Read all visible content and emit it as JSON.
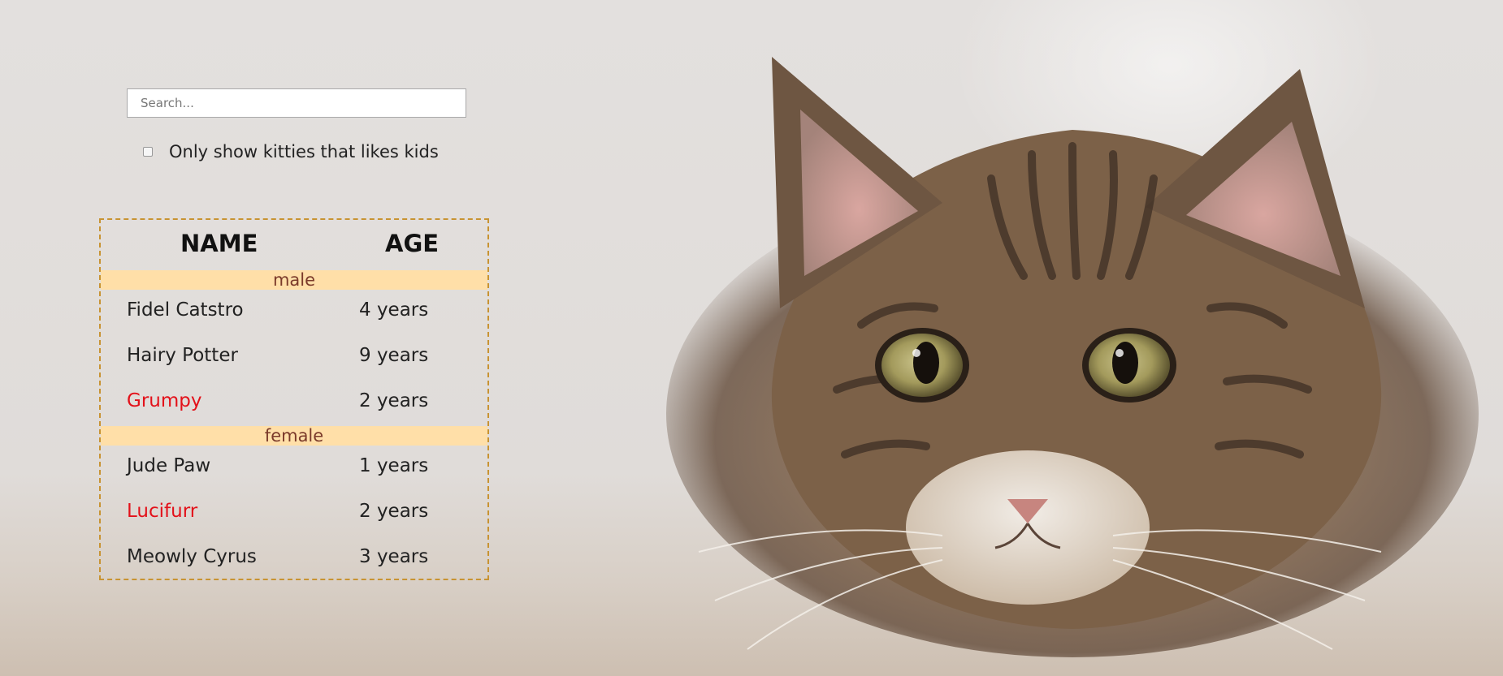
{
  "search": {
    "placeholder": "Search...",
    "value": ""
  },
  "filter": {
    "label": "Only show kitties that likes kids",
    "checked": false
  },
  "table": {
    "headers": {
      "name": "NAME",
      "age": "AGE"
    },
    "groups": [
      {
        "label": "male",
        "rows": [
          {
            "name": "Fidel Catstro",
            "age": "4 years",
            "likes_kids": true
          },
          {
            "name": "Hairy Potter",
            "age": "9 years",
            "likes_kids": true
          },
          {
            "name": "Grumpy",
            "age": "2 years",
            "likes_kids": false
          }
        ]
      },
      {
        "label": "female",
        "rows": [
          {
            "name": "Jude Paw",
            "age": "1 years",
            "likes_kids": true
          },
          {
            "name": "Lucifurr",
            "age": "2 years",
            "likes_kids": false
          },
          {
            "name": "Meowly Cyrus",
            "age": "3 years",
            "likes_kids": true
          }
        ]
      }
    ]
  },
  "colors": {
    "table_border": "#c89332",
    "group_bg": "#ffdfa8",
    "group_text": "#7a3a2a",
    "no_kids_text": "#e3111a"
  },
  "background": {
    "icon": "cat-photo"
  }
}
